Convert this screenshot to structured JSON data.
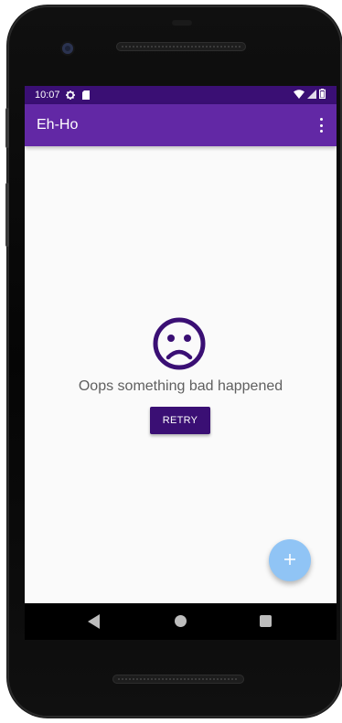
{
  "status_bar": {
    "time": "10:07",
    "icons": [
      "gear-icon",
      "sd-card-icon",
      "wifi-icon",
      "signal-icon",
      "battery-icon"
    ]
  },
  "app_bar": {
    "title": "Eh-Ho",
    "menu_icon": "more-vert-icon"
  },
  "error_state": {
    "icon": "sad-face-icon",
    "message": "Oops something bad happened",
    "retry_label": "RETRY"
  },
  "fab": {
    "icon": "plus-icon"
  },
  "nav_bar": {
    "icons": [
      "back-icon",
      "home-icon",
      "recents-icon"
    ]
  },
  "colors": {
    "status_bar": "#3a0f74",
    "app_bar": "#6228a5",
    "primary_dark": "#3a0f74",
    "fab": "#90c4f5",
    "background": "#fafafa"
  }
}
